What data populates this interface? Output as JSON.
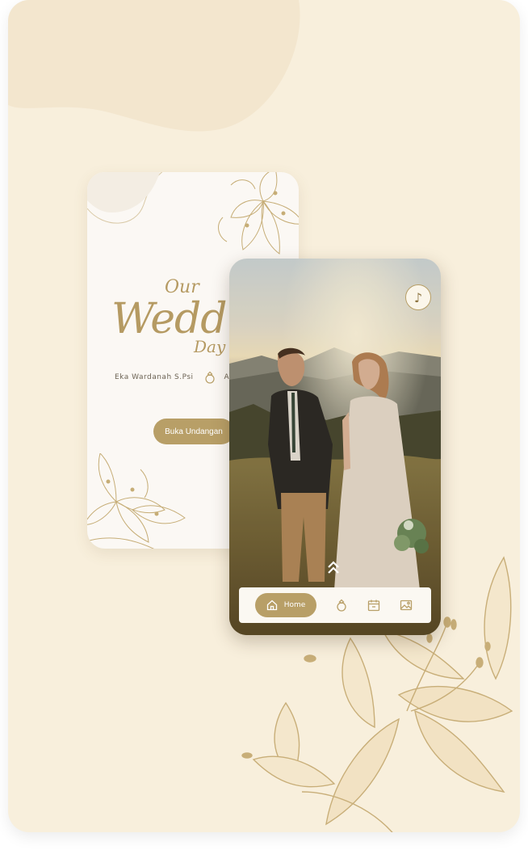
{
  "cover": {
    "title_our": "Our",
    "title_wedding": "Wedd",
    "title_day": "Day",
    "name_left": "Eka Wardanah S.Psi",
    "name_right": "Ari",
    "open_button": "Buka Undangan"
  },
  "player": {
    "music_icon": "music-note-icon",
    "music_glyph": "♪"
  },
  "navbar": {
    "home_label": "Home",
    "icons": [
      "home-icon",
      "ring-icon",
      "calendar-icon",
      "gallery-icon"
    ]
  },
  "colors": {
    "background": "#f8efdc",
    "accent_gold": "#b89f67",
    "cover_bg": "#fbf8f4"
  }
}
